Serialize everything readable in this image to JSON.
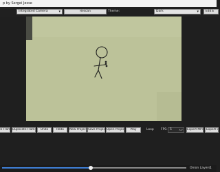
{
  "window": {
    "title": "p by Sergei Jesse"
  },
  "top": {
    "camera_select": "Integrated Camera",
    "rescan_label": "Rescan",
    "theme_label": "Theme:",
    "theme_select": "Dark",
    "edit_label": "Edit E"
  },
  "toolbar": {
    "delete_frame": "te Frame",
    "duplicate_frame": "Duplicate Frame",
    "undo": "Undo",
    "redo": "Redo",
    "new_project": "New Project",
    "save_project": "Save Project",
    "open_project": "Open Project",
    "play": "Play",
    "loop": "Loop",
    "fps_label": "FPS:",
    "fps_value": "5",
    "export_mp4": "Export MP4",
    "export_g": "Export G"
  },
  "timeline": {
    "onion_label": "Onion Layers:",
    "onion_value": "1",
    "progress": 0.48
  },
  "colors": {
    "accent": "#3f7fd6",
    "canvas": "#bcc299"
  }
}
